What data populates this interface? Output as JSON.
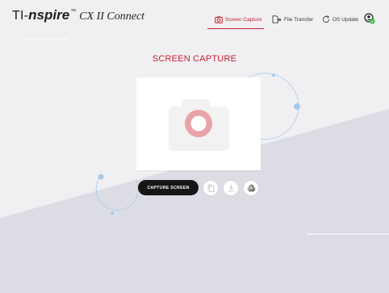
{
  "header": {
    "logo": {
      "ti": "TI-",
      "nspire": "nspire",
      "tm": "™",
      "product": "CX II Connect"
    },
    "nav": [
      {
        "label": "Screen Capture",
        "icon": "camera-icon",
        "active": true
      },
      {
        "label": "File Transfer",
        "icon": "file-transfer-icon",
        "active": false
      },
      {
        "label": "OS Update",
        "icon": "refresh-icon",
        "active": false
      }
    ],
    "account_icon": "account-connected-icon"
  },
  "main": {
    "title": "SCREEN CAPTURE",
    "capture_button": "CAPTURE SCREEN",
    "actions": [
      {
        "icon": "copy-icon"
      },
      {
        "icon": "download-icon"
      },
      {
        "icon": "google-drive-icon"
      }
    ]
  },
  "colors": {
    "accent": "#c8202e",
    "button_dark": "#161616",
    "background": "#f0f0f3",
    "decor_blue": "#a7c9ec",
    "camera_placeholder": "#f2f2f2",
    "lens_pink": "#e8a4a8",
    "status_green": "#2fae3a"
  }
}
